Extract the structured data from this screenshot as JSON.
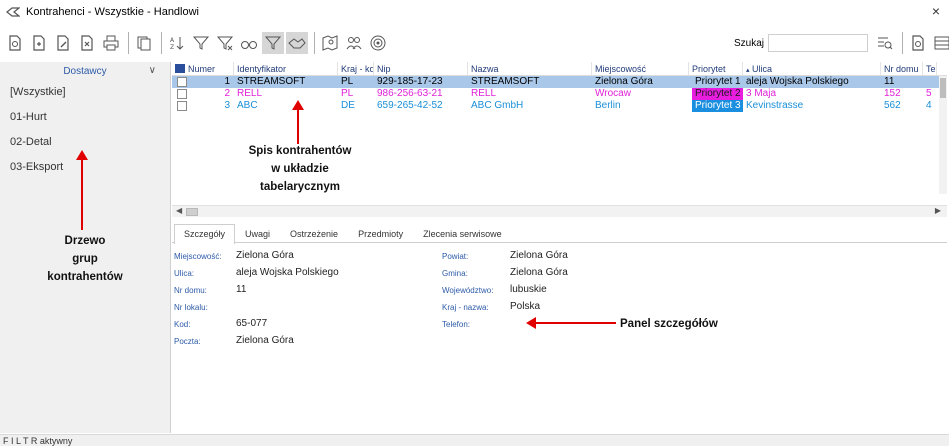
{
  "window": {
    "title": "Kontrahenci - Wszystkie - Handlowi",
    "close_glyph": "×"
  },
  "toolbar": {
    "buttons": [
      "new-doc-icon",
      "new-doc-plus-icon",
      "edit-doc-icon",
      "delete-doc-icon",
      "print-icon",
      "copy-icon",
      "sort-icon",
      "filter-icon",
      "filter-clear-icon",
      "find-icon",
      "filter-active-icon",
      "handshake-icon",
      "map-icon",
      "group-icon",
      "target-icon"
    ],
    "search_label": "Szukaj",
    "search_value": "",
    "right_buttons": [
      "advanced-search-icon",
      "doc-icon",
      "panel-icon"
    ]
  },
  "tree": {
    "header": "Dostawcy",
    "items": [
      "[Wszystkie]",
      "01-Hurt",
      "02-Detal",
      "03-Eksport"
    ]
  },
  "grid": {
    "columns": [
      "Numer",
      "Identyfikator",
      "Kraj - kod",
      "Nip",
      "Nazwa",
      "Miejscowość",
      "Priorytet",
      "Ulica",
      "Nr domu",
      "Te"
    ],
    "rows": [
      {
        "numer": "1",
        "identyfikator": "STREAMSOFT",
        "kraj": "PL",
        "nip": "929-185-17-23",
        "nazwa": "STREAMSOFT",
        "miejscowosc": "Zielona Góra",
        "priorytet": "Priorytet 1",
        "ulica": "aleja Wojska Polskiego",
        "nr_domu": "11",
        "te": "",
        "color": "#000000",
        "prio_bg": "",
        "prio_color": "#000000"
      },
      {
        "numer": "2",
        "identyfikator": "RELL",
        "kraj": "PL",
        "nip": "986-256-63-21",
        "nazwa": "RELL",
        "miejscowosc": "Wrocaw",
        "priorytet": "Priorytet 2",
        "ulica": "3 Maja",
        "nr_domu": "152",
        "te": "5",
        "color": "#e020d8",
        "prio_bg": "#e81de0",
        "prio_color": "#1a1a1a"
      },
      {
        "numer": "3",
        "identyfikator": "ABC",
        "kraj": "DE",
        "nip": "659-265-42-52",
        "nazwa": "ABC GmbH",
        "miejscowosc": "Berlin",
        "priorytet": "Priorytet 3",
        "ulica": "Kevinstrasse",
        "nr_domu": "562",
        "te": "4",
        "color": "#1a8fd8",
        "prio_bg": "#1a8fe0",
        "prio_color": "#ffffff"
      }
    ]
  },
  "tabs": [
    "Szczegóły",
    "Uwagi",
    "Ostrzeżenie",
    "Przedmioty",
    "Zlecenia serwisowe"
  ],
  "details": {
    "miejscowosc_label": "Miejscowość:",
    "miejscowosc": "Zielona Góra",
    "ulica_label": "Ulica:",
    "ulica": "aleja Wojska Polskiego",
    "nr_domu_label": "Nr domu:",
    "nr_domu": "11",
    "nr_lokalu_label": "Nr lokalu:",
    "nr_lokalu": "",
    "kod_label": "Kod:",
    "kod": "65-077",
    "poczta_label": "Poczta:",
    "poczta": "Zielona Góra",
    "powiat_label": "Powiat:",
    "powiat": "Zielona Góra",
    "gmina_label": "Gmina:",
    "gmina": "Zielona Góra",
    "wojewodztwo_label": "Województwo:",
    "wojewodztwo": "lubuskie",
    "kraj_label": "Kraj - nazwa:",
    "kraj": "Polska",
    "telefon_label": "Telefon:",
    "telefon": ""
  },
  "annotations": {
    "grid_note": [
      "Spis kontrahentów",
      "w układzie",
      "tabelarycznym"
    ],
    "tree_note": [
      "Drzewo",
      "grup",
      "kontrahentów"
    ],
    "panel_note": "Panel szczegółów"
  },
  "status": {
    "text": "F I L T R aktywny"
  }
}
